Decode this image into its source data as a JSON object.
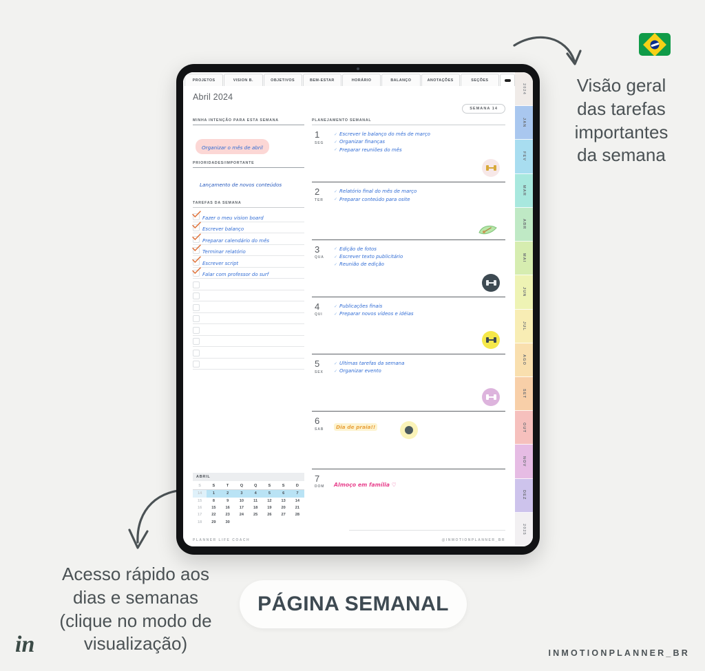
{
  "annotations": {
    "right": "Visão geral\ndas tarefas\nimportantes\nda semana",
    "left": "Acesso rápido aos\ndias e semanas\n(clique no modo de\nvisualização)"
  },
  "badge": {
    "label": "PÁGINA SEMANAL"
  },
  "brand": {
    "logo": "in",
    "handle": "INMOTIONPLANNER_BR"
  },
  "flag": {
    "name": "brazil-flag",
    "green": "#109b48",
    "yellow": "#f7d117",
    "blue": "#0a2e8c"
  },
  "tablet": {
    "tabs": [
      "PROJETOS",
      "VISION B.",
      "OBJETIVOS",
      "BEM-ESTAR",
      "HORÁRIO",
      "BALANÇO",
      "ANOTAÇÕES",
      "SEÇÕES"
    ],
    "month_title": "Abril 2024",
    "week_badge": "SEMANA 14",
    "left_panel": {
      "intention_head": "MINHA INTENÇÃO PARA ESTA SEMANA",
      "intention_text": "Organizar o mês de abril",
      "priorities_head": "PRIORIDADES/IMPORTANTE",
      "priorities_text": "Lançamento de novos conteúdos",
      "tasks_head": "TAREFAS DA SEMANA",
      "tasks": [
        {
          "text": "Fazer o meu vision board",
          "done": true
        },
        {
          "text": "Escrever balanço",
          "done": true
        },
        {
          "text": "Preparar calendário do mês",
          "done": true
        },
        {
          "text": "Terminar relatório",
          "done": true
        },
        {
          "text": "Escrever script",
          "done": true
        },
        {
          "text": "Falar com professor do surf",
          "done": true
        },
        {
          "text": "",
          "done": false
        },
        {
          "text": "",
          "done": false
        },
        {
          "text": "",
          "done": false
        },
        {
          "text": "",
          "done": false
        },
        {
          "text": "",
          "done": false
        },
        {
          "text": "",
          "done": false
        },
        {
          "text": "",
          "done": false
        },
        {
          "text": "",
          "done": false
        }
      ]
    },
    "calendar": {
      "month": "ABRIL",
      "weekday_headers": [
        "S",
        "S",
        "T",
        "Q",
        "Q",
        "S",
        "S",
        "D"
      ],
      "rows": [
        {
          "week": "14",
          "days": [
            "1",
            "2",
            "3",
            "4",
            "5",
            "6",
            "7"
          ],
          "highlight": true
        },
        {
          "week": "15",
          "days": [
            "8",
            "9",
            "10",
            "11",
            "12",
            "13",
            "14"
          ],
          "highlight": false
        },
        {
          "week": "16",
          "days": [
            "15",
            "16",
            "17",
            "18",
            "19",
            "20",
            "21"
          ],
          "highlight": false
        },
        {
          "week": "17",
          "days": [
            "22",
            "23",
            "24",
            "25",
            "26",
            "27",
            "28"
          ],
          "highlight": false
        },
        {
          "week": "18",
          "days": [
            "29",
            "30",
            "",
            "",
            "",
            "",
            ""
          ],
          "highlight": false
        }
      ],
      "highlight_color": "#b9e3f5"
    },
    "planner": {
      "head": "PLANEJAMENTO SEMANAL",
      "days": [
        {
          "num": "1",
          "label": "SEG",
          "tasks": [
            "Escrever le balanço do mês de março",
            "Organizar finanças",
            "Preparar reuniões do mês"
          ],
          "sticker": "dumbbell-icon",
          "sticker_bg": "#f7e8e8",
          "sticker_color": "#d8a93a"
        },
        {
          "num": "2",
          "label": "TER",
          "tasks": [
            "Relatório final do mês de março",
            "Preparar conteúdo para osite"
          ],
          "sticker": "leaf-icon",
          "sticker_bg": "transparent",
          "sticker_color": "#8fcf8a"
        },
        {
          "num": "3",
          "label": "QUA",
          "tasks": [
            "Edição de fotos",
            "Escrever texto publicitário",
            "Reunião de edição"
          ],
          "sticker": "dumbbell-icon",
          "sticker_bg": "#3d4a52",
          "sticker_color": "#e9ecee"
        },
        {
          "num": "4",
          "label": "QUI",
          "tasks": [
            "Publicações finais",
            "Preparar novos vídeos e idéias"
          ],
          "sticker": "dumbbell-icon",
          "sticker_bg": "#f5e84a",
          "sticker_color": "#3d4a52"
        },
        {
          "num": "5",
          "label": "SEX",
          "tasks": [
            "Ultimas tarefas da semana",
            "Organizar evento"
          ],
          "sticker": "dumbbell-icon",
          "sticker_bg": "#ddb4dd",
          "sticker_color": "#ffffff"
        },
        {
          "num": "6",
          "label": "SAB",
          "note": "Dia de praia!!",
          "note_color": "#e8a13c",
          "sticker": "sun-icon",
          "sticker_bg": "#faf3b8",
          "sticker_color": "#4b5a5e"
        },
        {
          "num": "7",
          "label": "DOM",
          "note": "Almoço em família  ♡",
          "note_color": "#e8458f",
          "sticker": "",
          "sticker_bg": "transparent",
          "sticker_color": ""
        }
      ]
    },
    "page_footer": {
      "left": "PLANNER LIFE COACH",
      "right": "@INMOTIONPLANNER_BR"
    },
    "month_rail": [
      {
        "label": "2024",
        "color": "#f0ebe8",
        "year": true
      },
      {
        "label": "JAN",
        "color": "#a9c7ef",
        "year": false
      },
      {
        "label": "FEV",
        "color": "#a8ddf0",
        "year": false
      },
      {
        "label": "MAR",
        "color": "#a8e8de",
        "year": false
      },
      {
        "label": "ABR",
        "color": "#bfe9c5",
        "year": false
      },
      {
        "label": "MAI",
        "color": "#d6edb0",
        "year": false
      },
      {
        "label": "JUN",
        "color": "#eef3b4",
        "year": false
      },
      {
        "label": "JUL",
        "color": "#f8edb4",
        "year": false
      },
      {
        "label": "AGO",
        "color": "#f9dfae",
        "year": false
      },
      {
        "label": "SET",
        "color": "#f8cfa8",
        "year": false
      },
      {
        "label": "OUT",
        "color": "#f6c0bd",
        "year": false
      },
      {
        "label": "NOV",
        "color": "#e6bce4",
        "year": false
      },
      {
        "label": "DEZ",
        "color": "#cdc3ec",
        "year": false
      },
      {
        "label": "2025",
        "color": "#f2f0f2",
        "year": true
      }
    ]
  }
}
